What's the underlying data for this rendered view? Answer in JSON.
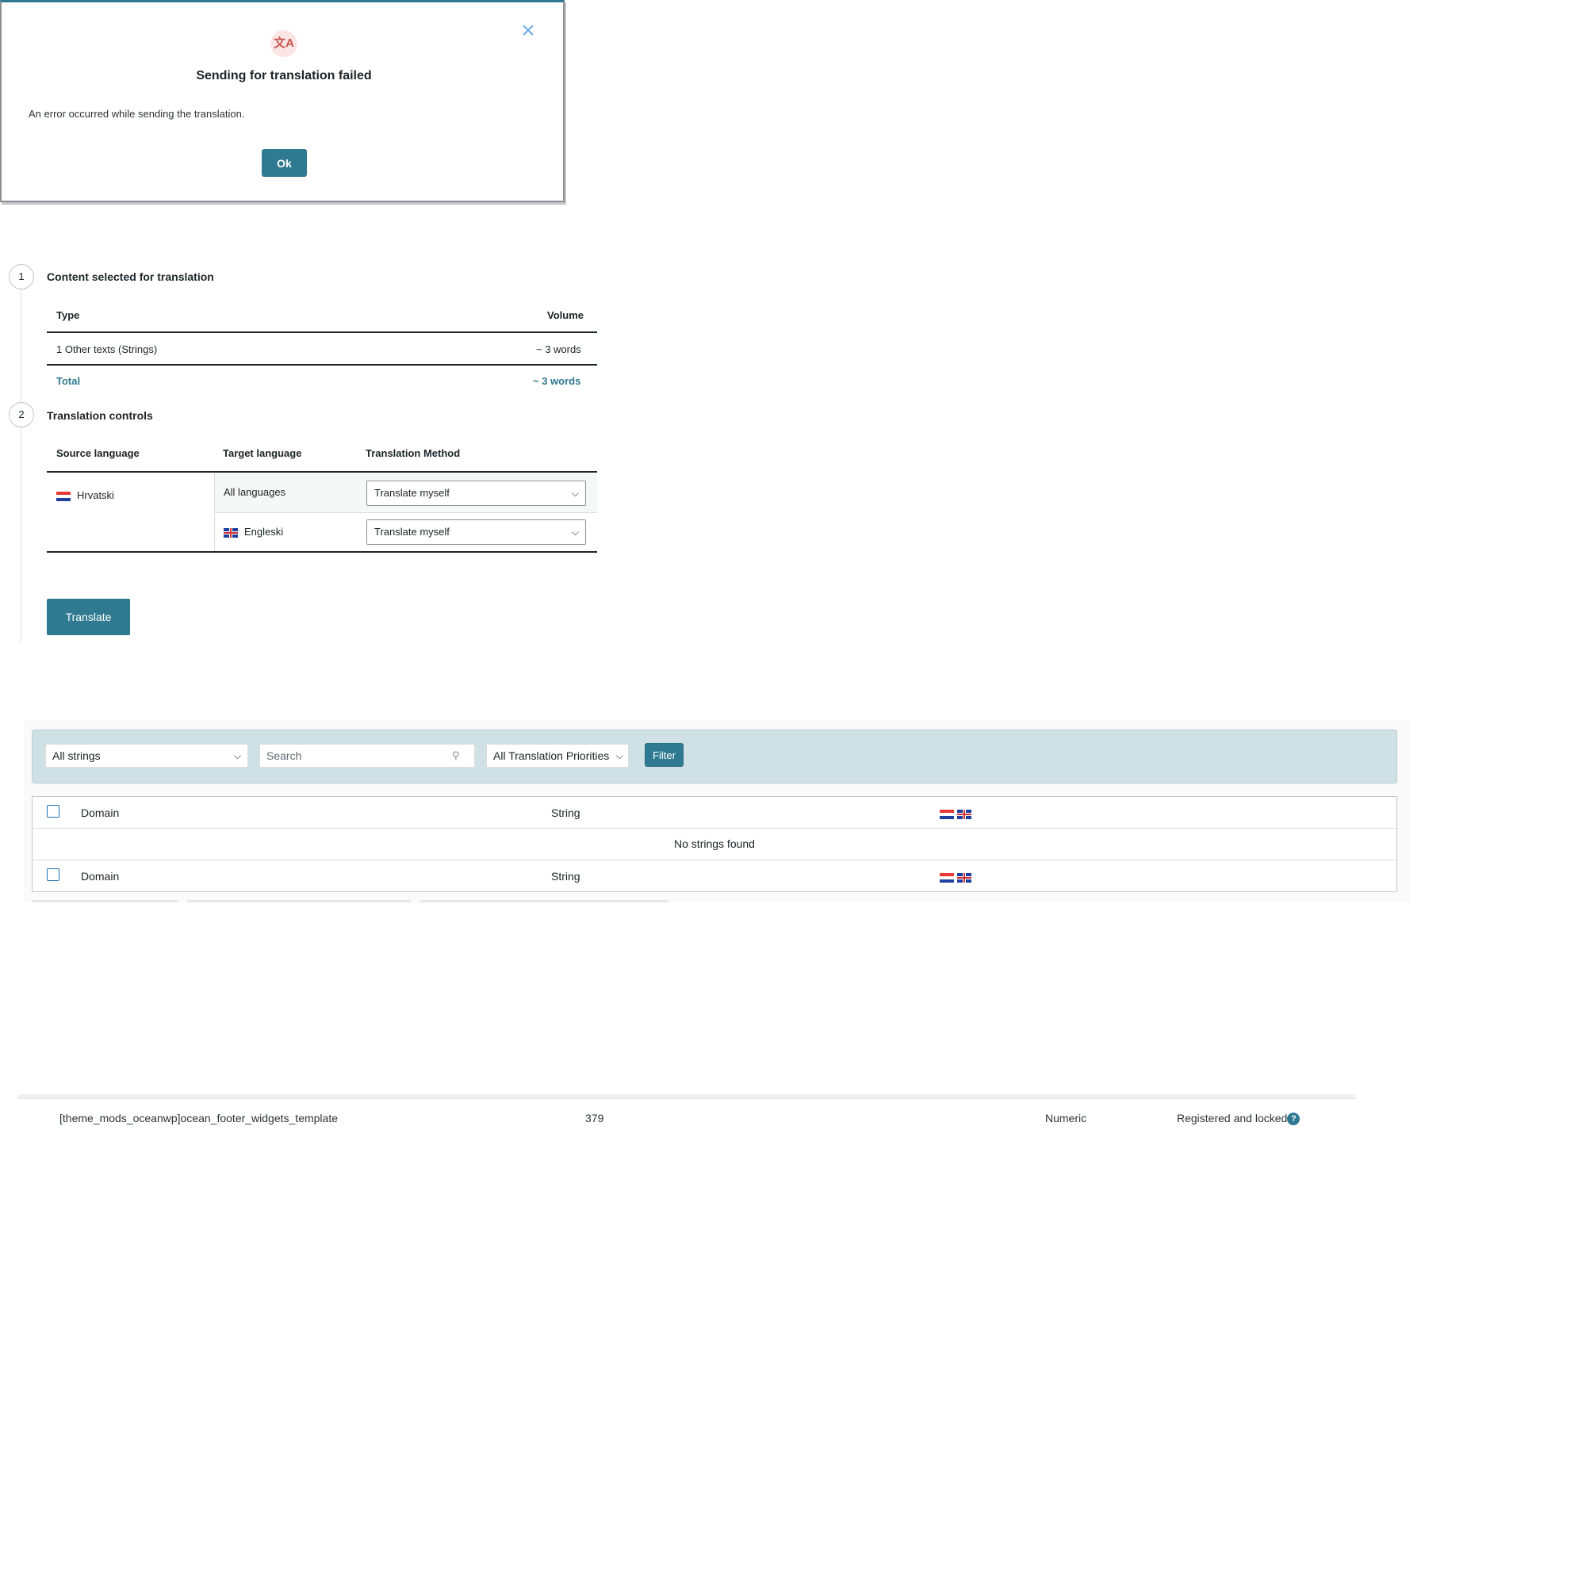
{
  "modal": {
    "title": "Sending for translation failed",
    "message": "An error occurred while sending the translation.",
    "ok_label": "Ok",
    "close_glyph": "×",
    "icon": "translate-icon",
    "icon_glyph": "文A"
  },
  "step1": {
    "number": "1",
    "title": "Content selected for translation",
    "columns": {
      "type": "Type",
      "volume": "Volume"
    },
    "rows": [
      {
        "type": "1 Other texts (Strings)",
        "volume": "~ 3 words"
      }
    ],
    "total_label": "Total",
    "total_volume": "~ 3 words"
  },
  "step2": {
    "number": "2",
    "title": "Translation controls",
    "columns": {
      "source": "Source language",
      "target": "Target language",
      "method": "Translation Method"
    },
    "source_language": "Hrvatski",
    "targets": [
      {
        "label": "All languages",
        "method": "Translate myself"
      },
      {
        "label": "Engleski",
        "method": "Translate myself"
      }
    ]
  },
  "translate_button": "Translate",
  "strings": {
    "filter_select": "All strings",
    "search_placeholder": "Search",
    "priority_select": "All Translation Priorities",
    "filter_button": "Filter",
    "header": {
      "domain": "Domain",
      "string": "String"
    },
    "empty_message": "No strings found"
  },
  "bottom_row": {
    "name": "[theme_mods_oceanwp]ocean_footer_widgets_template",
    "value": "379",
    "type": "Numeric",
    "status": "Registered and locked",
    "help_glyph": "?"
  },
  "colors": {
    "accent": "#2f7a90",
    "filter_bar": "#d0e1e6",
    "error_icon_bg": "#fbe5e5"
  }
}
